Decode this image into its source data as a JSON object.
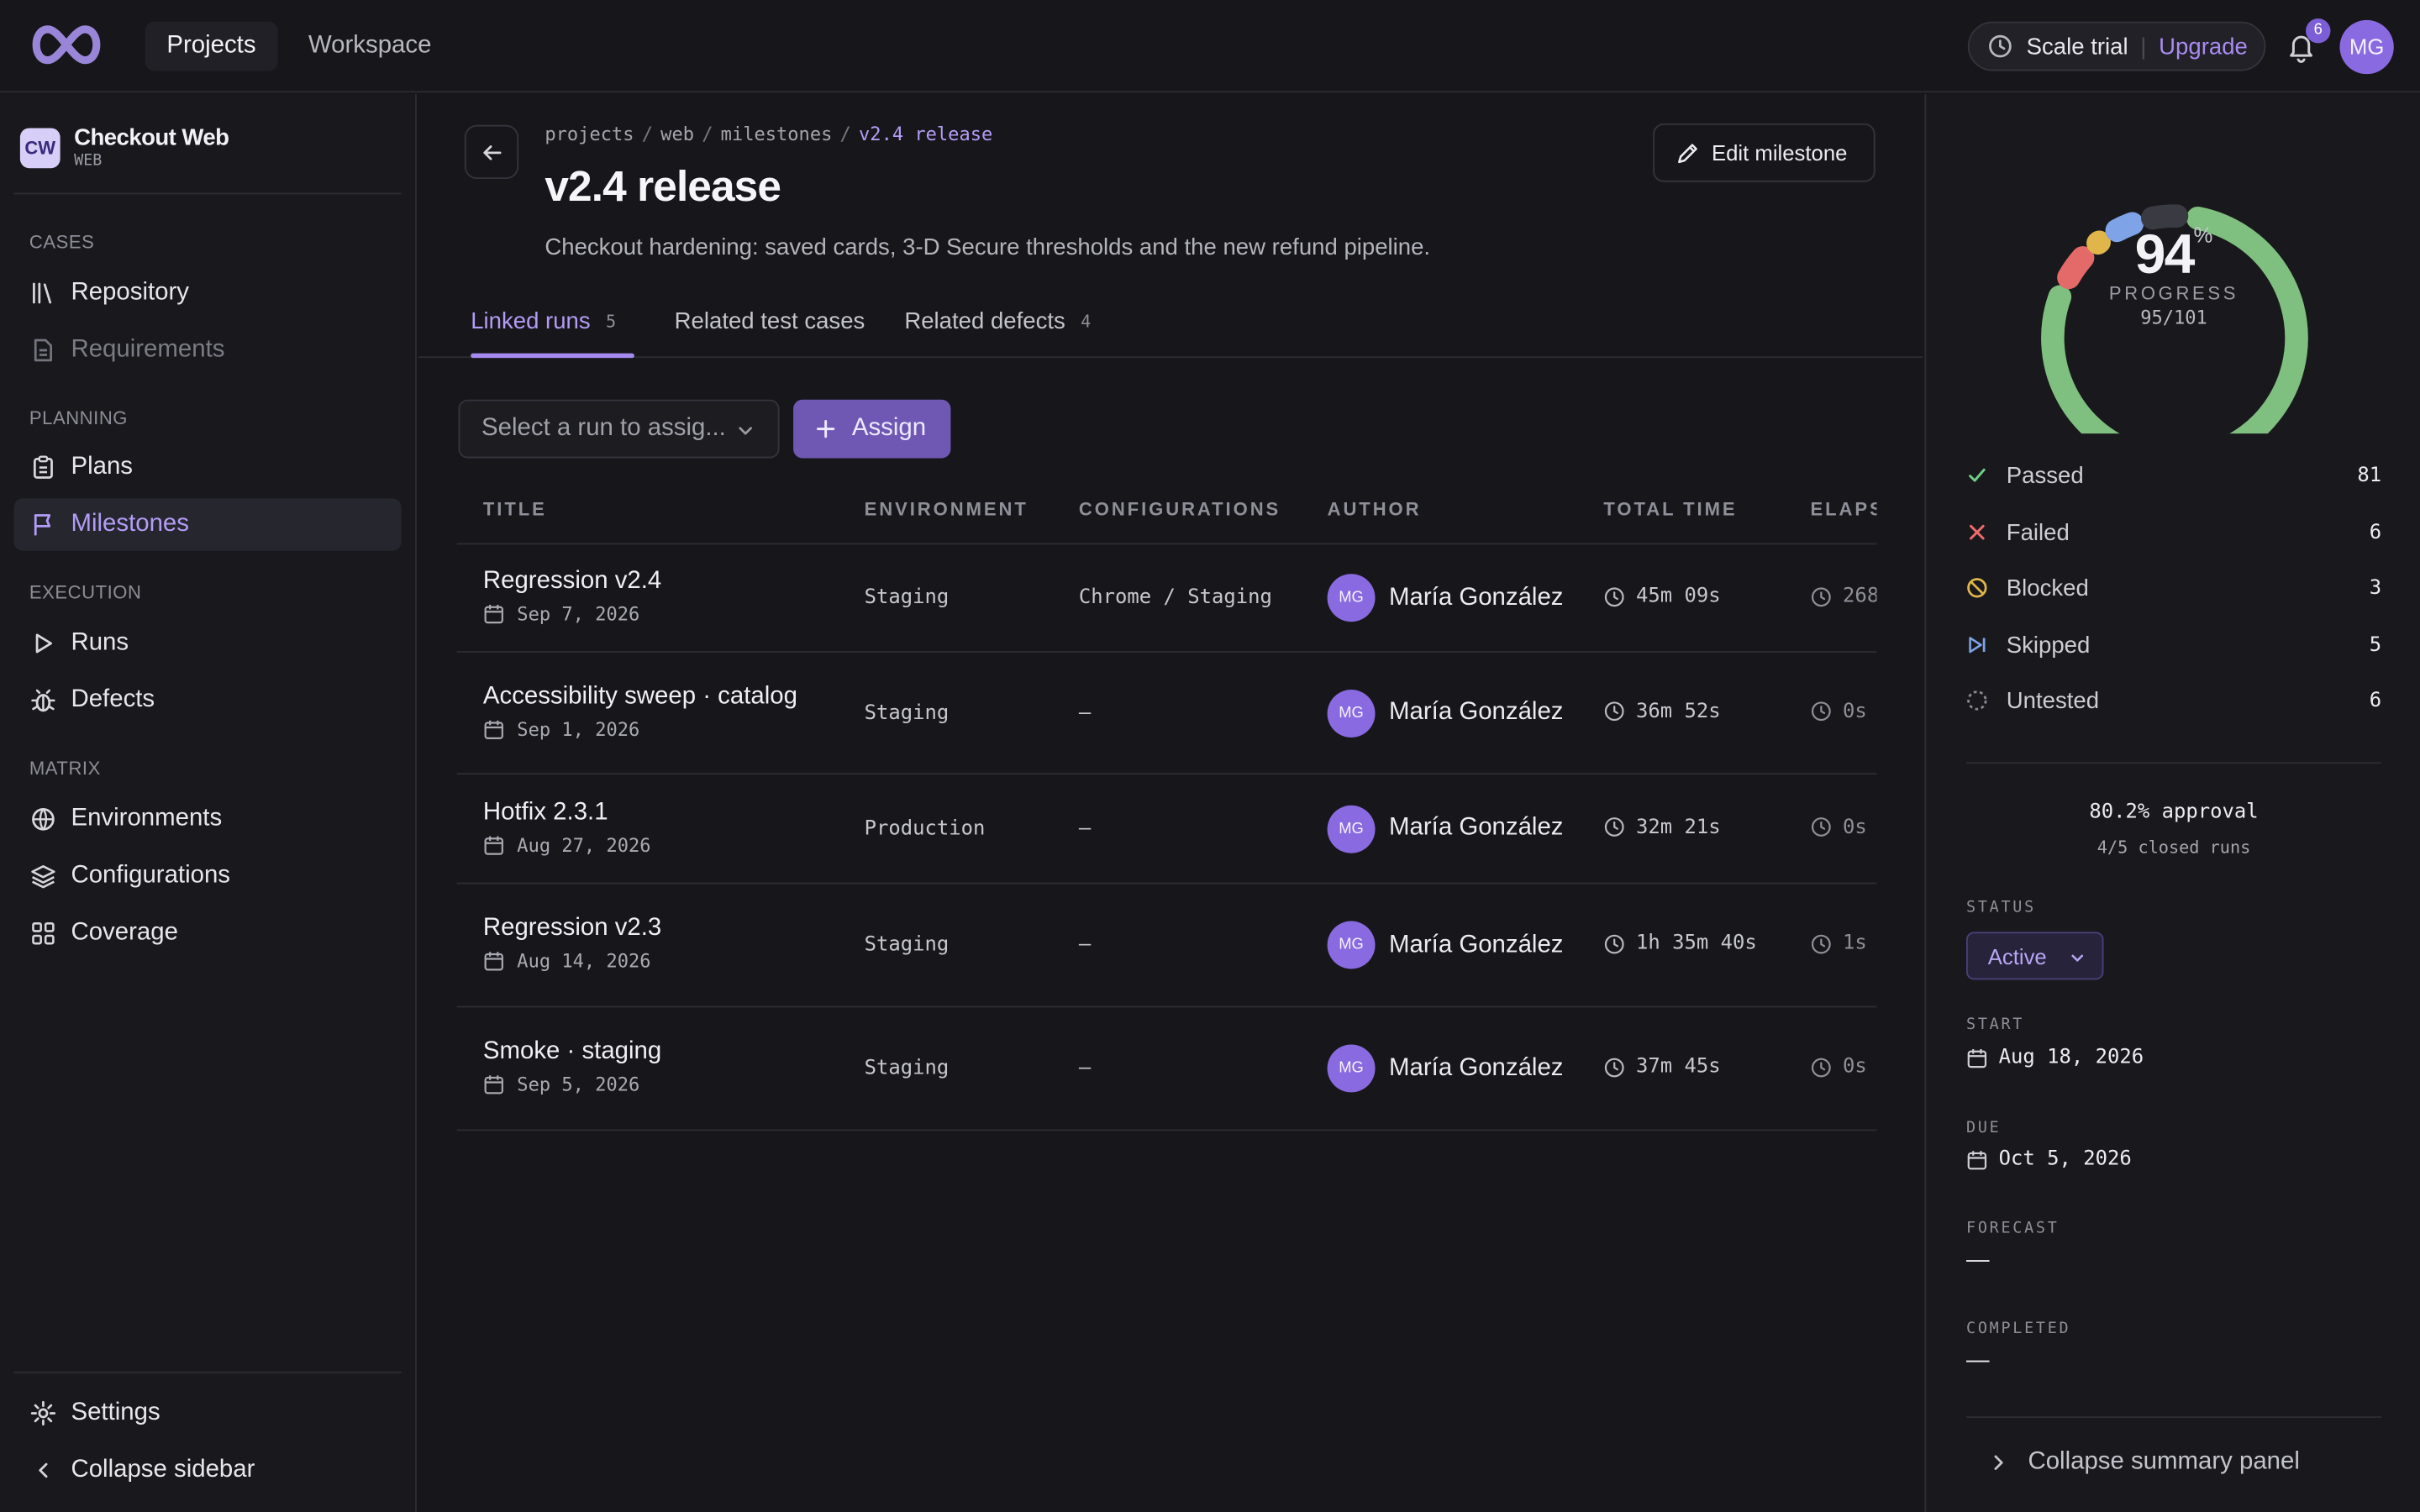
{
  "topbar": {
    "nav": [
      "Projects",
      "Workspace"
    ],
    "trial_label": "Scale trial",
    "upgrade_label": "Upgrade",
    "notification_count": "6",
    "user_initials": "MG"
  },
  "sidebar": {
    "project_badge": "CW",
    "project_name": "Checkout Web",
    "project_sub": "WEB",
    "sections": {
      "cases": "CASES",
      "planning": "PLANNING",
      "execution": "EXECUTION",
      "matrix": "MATRIX"
    },
    "items": {
      "repository": "Repository",
      "requirements": "Requirements",
      "plans": "Plans",
      "milestones": "Milestones",
      "runs": "Runs",
      "defects": "Defects",
      "environments": "Environments",
      "configurations": "Configurations",
      "coverage": "Coverage",
      "settings": "Settings",
      "collapse": "Collapse sidebar"
    }
  },
  "main": {
    "breadcrumb": [
      "projects",
      "web",
      "milestones",
      "v2.4 release"
    ],
    "title": "v2.4 release",
    "description": "Checkout hardening: saved cards, 3-D Secure thresholds and the new refund pipeline.",
    "edit_label": "Edit milestone",
    "tabs": [
      {
        "label": "Linked runs",
        "count": "5"
      },
      {
        "label": "Related test cases",
        "count": ""
      },
      {
        "label": "Related defects",
        "count": "4"
      }
    ],
    "select_placeholder": "Select a run to assig...",
    "assign_label": "Assign",
    "columns": [
      "TITLE",
      "ENVIRONMENT",
      "CONFIGURATIONS",
      "AUTHOR",
      "TOTAL TIME",
      "ELAPS"
    ],
    "rows": [
      {
        "title": "Regression v2.4",
        "date": "Sep 7, 2026",
        "env": "Staging",
        "config": "Chrome / Staging",
        "author_initials": "MG",
        "author": "María González",
        "total": "45m 09s",
        "elapsed": "268"
      },
      {
        "title": "Accessibility sweep · catalog",
        "date": "Sep 1, 2026",
        "env": "Staging",
        "config": "—",
        "author_initials": "MG",
        "author": "María González",
        "total": "36m 52s",
        "elapsed": "0s"
      },
      {
        "title": "Hotfix 2.3.1",
        "date": "Aug 27, 2026",
        "env": "Production",
        "config": "—",
        "author_initials": "MG",
        "author": "María González",
        "total": "32m 21s",
        "elapsed": "0s"
      },
      {
        "title": "Regression v2.3",
        "date": "Aug 14, 2026",
        "env": "Staging",
        "config": "—",
        "author_initials": "MG",
        "author": "María González",
        "total": "1h 35m 40s",
        "elapsed": "1s"
      },
      {
        "title": "Smoke · staging",
        "date": "Sep 5, 2026",
        "env": "Staging",
        "config": "—",
        "author_initials": "MG",
        "author": "María González",
        "total": "37m 45s",
        "elapsed": "0s"
      }
    ]
  },
  "summary": {
    "progress_value": "94",
    "progress_symbol": "%",
    "progress_label": "PROGRESS",
    "progress_count": "95/101",
    "stats": [
      {
        "label": "Passed",
        "value": "81",
        "color": "#6fcf86",
        "icon": "check-icon"
      },
      {
        "label": "Failed",
        "value": "6",
        "color": "#ef6b6b",
        "icon": "x-icon"
      },
      {
        "label": "Blocked",
        "value": "3",
        "color": "#e0b54a",
        "icon": "blocked-icon"
      },
      {
        "label": "Skipped",
        "value": "5",
        "color": "#7ea3e6",
        "icon": "skip-icon"
      },
      {
        "label": "Untested",
        "value": "6",
        "color": "#8a8a94",
        "icon": "untested-icon"
      }
    ],
    "approval": "80.2% approval",
    "closed_runs": "4/5 closed runs",
    "status_label": "STATUS",
    "status_value": "Active",
    "start_label": "START",
    "start_value": "Aug 18, 2026",
    "due_label": "DUE",
    "due_value": "Oct 5, 2026",
    "forecast_label": "FORECAST",
    "forecast_value": "—",
    "completed_label": "COMPLETED",
    "completed_value": "—",
    "collapse_label": "Collapse summary panel"
  },
  "colors": {
    "accent": "#a58af0",
    "passed": "#7fbf7f",
    "failed": "#e46a6a",
    "blocked": "#e0b54a",
    "skipped": "#7ea3e6",
    "untested": "#3a3a42"
  }
}
